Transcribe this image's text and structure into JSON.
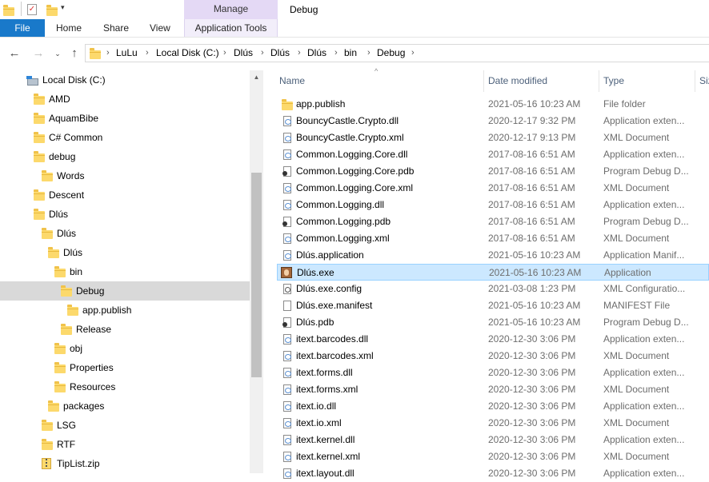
{
  "window": {
    "title": "Debug",
    "manage_label": "Manage"
  },
  "ribbon": {
    "file": "File",
    "home": "Home",
    "share": "Share",
    "view": "View",
    "app_tools": "Application Tools"
  },
  "address": {
    "crumbs": [
      "LuLu",
      "Local Disk (C:)",
      "Dlús",
      "Dlús",
      "Dlús",
      "bin",
      "Debug"
    ]
  },
  "nav": {
    "items": [
      {
        "label": "Local Disk (C:)",
        "icon": "drive-icon"
      },
      {
        "label": "AMD",
        "icon": "folder-icon"
      },
      {
        "label": "AquamBibe",
        "icon": "folder-icon"
      },
      {
        "label": "C# Common",
        "icon": "folder-icon"
      },
      {
        "label": "debug",
        "icon": "folder-icon"
      },
      {
        "label": "Words",
        "icon": "folder-icon"
      },
      {
        "label": "Descent",
        "icon": "folder-icon"
      },
      {
        "label": "Dlús",
        "icon": "folder-icon"
      },
      {
        "label": "Dlús",
        "icon": "folder-icon"
      },
      {
        "label": "Dlús",
        "icon": "folder-icon"
      },
      {
        "label": "bin",
        "icon": "folder-icon"
      },
      {
        "label": "Debug",
        "icon": "folder-icon"
      },
      {
        "label": "app.publish",
        "icon": "folder-icon"
      },
      {
        "label": "Release",
        "icon": "folder-icon"
      },
      {
        "label": "obj",
        "icon": "folder-icon"
      },
      {
        "label": "Properties",
        "icon": "folder-icon"
      },
      {
        "label": "Resources",
        "icon": "folder-icon"
      },
      {
        "label": "packages",
        "icon": "folder-icon"
      },
      {
        "label": "LSG",
        "icon": "folder-icon"
      },
      {
        "label": "RTF",
        "icon": "folder-icon"
      },
      {
        "label": "TipList.zip",
        "icon": "zip-icon"
      }
    ]
  },
  "columns": {
    "name": "Name",
    "date": "Date modified",
    "type": "Type",
    "size": "Siz"
  },
  "files": [
    {
      "name": "app.publish",
      "date": "2021-05-16 10:23 AM",
      "type": "File folder",
      "icon": "folder-icon"
    },
    {
      "name": "BouncyCastle.Crypto.dll",
      "date": "2020-12-17 9:32 PM",
      "type": "Application exten...",
      "icon": "dll-icon"
    },
    {
      "name": "BouncyCastle.Crypto.xml",
      "date": "2020-12-17 9:13 PM",
      "type": "XML Document",
      "icon": "xml-icon"
    },
    {
      "name": "Common.Logging.Core.dll",
      "date": "2017-08-16 6:51 AM",
      "type": "Application exten...",
      "icon": "dll-icon"
    },
    {
      "name": "Common.Logging.Core.pdb",
      "date": "2017-08-16 6:51 AM",
      "type": "Program Debug D...",
      "icon": "pdb-icon"
    },
    {
      "name": "Common.Logging.Core.xml",
      "date": "2017-08-16 6:51 AM",
      "type": "XML Document",
      "icon": "xml-icon"
    },
    {
      "name": "Common.Logging.dll",
      "date": "2017-08-16 6:51 AM",
      "type": "Application exten...",
      "icon": "dll-icon"
    },
    {
      "name": "Common.Logging.pdb",
      "date": "2017-08-16 6:51 AM",
      "type": "Program Debug D...",
      "icon": "pdb-icon"
    },
    {
      "name": "Common.Logging.xml",
      "date": "2017-08-16 6:51 AM",
      "type": "XML Document",
      "icon": "xml-icon"
    },
    {
      "name": "Dlús.application",
      "date": "2021-05-16 10:23 AM",
      "type": "Application Manif...",
      "icon": "manifest-icon"
    },
    {
      "name": "Dlús.exe",
      "date": "2021-05-16 10:23 AM",
      "type": "Application",
      "icon": "exe-icon",
      "selected": true
    },
    {
      "name": "Dlús.exe.config",
      "date": "2021-03-08 1:23 PM",
      "type": "XML Configuratio...",
      "icon": "config-icon"
    },
    {
      "name": "Dlús.exe.manifest",
      "date": "2021-05-16 10:23 AM",
      "type": "MANIFEST File",
      "icon": "blank-file-icon"
    },
    {
      "name": "Dlús.pdb",
      "date": "2021-05-16 10:23 AM",
      "type": "Program Debug D...",
      "icon": "pdb-icon"
    },
    {
      "name": "itext.barcodes.dll",
      "date": "2020-12-30 3:06 PM",
      "type": "Application exten...",
      "icon": "dll-icon"
    },
    {
      "name": "itext.barcodes.xml",
      "date": "2020-12-30 3:06 PM",
      "type": "XML Document",
      "icon": "xml-icon"
    },
    {
      "name": "itext.forms.dll",
      "date": "2020-12-30 3:06 PM",
      "type": "Application exten...",
      "icon": "dll-icon"
    },
    {
      "name": "itext.forms.xml",
      "date": "2020-12-30 3:06 PM",
      "type": "XML Document",
      "icon": "xml-icon"
    },
    {
      "name": "itext.io.dll",
      "date": "2020-12-30 3:06 PM",
      "type": "Application exten...",
      "icon": "dll-icon"
    },
    {
      "name": "itext.io.xml",
      "date": "2020-12-30 3:06 PM",
      "type": "XML Document",
      "icon": "xml-icon"
    },
    {
      "name": "itext.kernel.dll",
      "date": "2020-12-30 3:06 PM",
      "type": "Application exten...",
      "icon": "dll-icon"
    },
    {
      "name": "itext.kernel.xml",
      "date": "2020-12-30 3:06 PM",
      "type": "XML Document",
      "icon": "xml-icon"
    },
    {
      "name": "itext.layout.dll",
      "date": "2020-12-30 3:06 PM",
      "type": "Application exten...",
      "icon": "dll-icon"
    }
  ],
  "colors": {
    "file_tab": "#1979ca",
    "manage_band": "#e4d9f5",
    "selection": "#cce8ff",
    "nav_selection": "#d9d9d9"
  }
}
